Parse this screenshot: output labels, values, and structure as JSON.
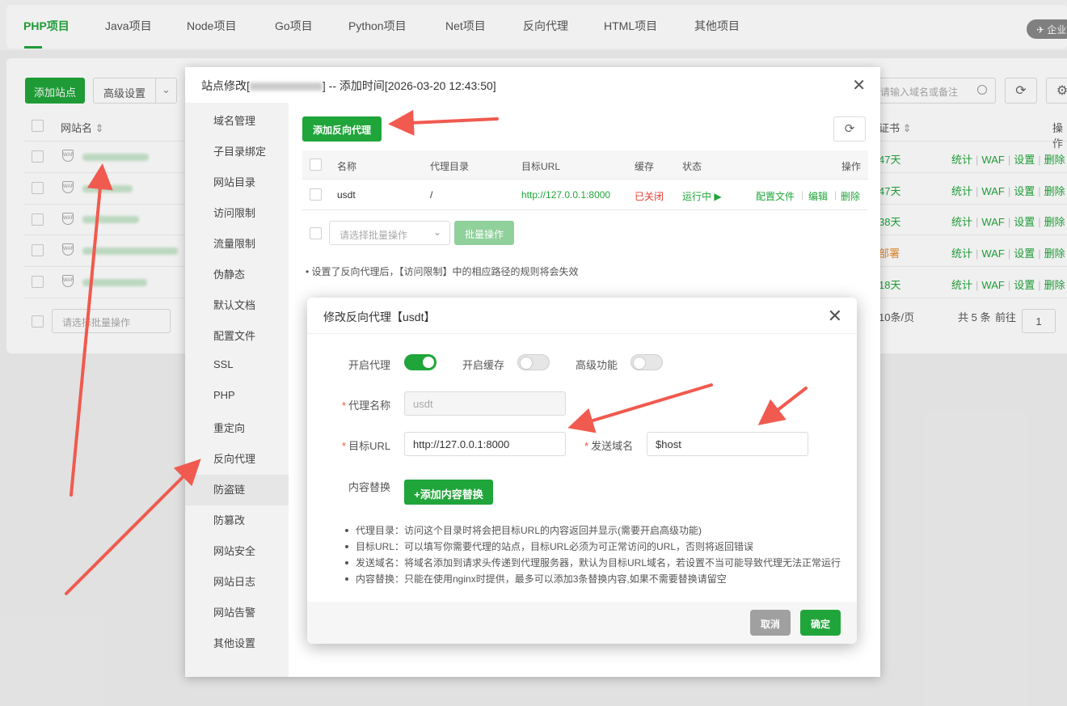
{
  "top_tabs": [
    "PHP项目",
    "Java项目",
    "Node项目",
    "Go项目",
    "Python项目",
    "Net项目",
    "反向代理",
    "HTML项目",
    "其他项目"
  ],
  "enterprise_badge": "企业",
  "site_list": {
    "add_site": "添加站点",
    "advanced": "高级设置",
    "col_name": "网站名",
    "col_cert": "证书",
    "col_ops": "操作",
    "search_placeholder": "请输入域名或备注",
    "rows": [
      {
        "days": "47天",
        "days_color": "#20a53a"
      },
      {
        "days": "47天",
        "days_color": "#20a53a"
      },
      {
        "days": "38天",
        "days_color": "#20a53a"
      },
      {
        "days": "部署",
        "days_color": "#e88a2e"
      },
      {
        "days": "18天",
        "days_color": "#20a53a"
      }
    ],
    "row_ops": [
      "统计",
      "WAF",
      "设置",
      "删除"
    ],
    "batch_placeholder": "请选择批量操作",
    "page_size": "10条/页",
    "total": "共 5 条",
    "goto": "前往",
    "page": "1"
  },
  "site_window": {
    "title_prefix": "站点修改[",
    "title_suffix": "] -- 添加时间[2026-03-20 12:43:50]",
    "menu": [
      "域名管理",
      "子目录绑定",
      "网站目录",
      "访问限制",
      "流量限制",
      "伪静态",
      "默认文档",
      "配置文件",
      "SSL",
      "PHP",
      "重定向",
      "反向代理",
      "防盗链",
      "防篡改",
      "网站安全",
      "网站日志",
      "网站告警",
      "其他设置"
    ],
    "active_menu": "反向代理",
    "add_proxy_button": "添加反向代理",
    "table_headers": [
      "名称",
      "代理目录",
      "目标URL",
      "缓存",
      "状态",
      "操作"
    ],
    "row": {
      "name": "usdt",
      "dir": "/",
      "url": "http://127.0.0.1:8000",
      "cache": "已关闭",
      "status": "运行中 ▶",
      "op_config": "配置文件",
      "op_edit": "编辑",
      "op_delete": "删除"
    },
    "batch_placeholder": "请选择批量操作",
    "batch_button": "批量操作",
    "note": "设置了反向代理后，【访问限制】中的相应路径的规则将会失效"
  },
  "modal": {
    "title": "修改反向代理【usdt】",
    "enable_proxy_label": "开启代理",
    "enable_proxy": true,
    "enable_cache_label": "开启缓存",
    "enable_cache": false,
    "advanced_label": "高级功能",
    "advanced": false,
    "proxy_name_label": "代理名称",
    "proxy_name_value": "usdt",
    "target_url_label": "目标URL",
    "target_url_value": "http://127.0.0.1:8000",
    "send_domain_label": "发送域名",
    "send_domain_value": "$host",
    "content_replace_label": "内容替换",
    "add_replace_button": "+添加内容替换",
    "tips": [
      "代理目录：访问这个目录时将会把目标URL的内容返回并显示(需要开启高级功能)",
      "目标URL：可以填写你需要代理的站点，目标URL必须为可正常访问的URL，否则将返回错误",
      "发送域名：将域名添加到请求头传递到代理服务器，默认为目标URL域名，若设置不当可能导致代理无法正常运行",
      "内容替换：只能在使用nginx时提供，最多可以添加3条替换内容,如果不需要替换请留空"
    ],
    "cancel": "取消",
    "confirm": "确定"
  },
  "colors": {
    "accent": "#20a53a",
    "danger": "#e53e30",
    "arrow": "#f05a4f"
  }
}
